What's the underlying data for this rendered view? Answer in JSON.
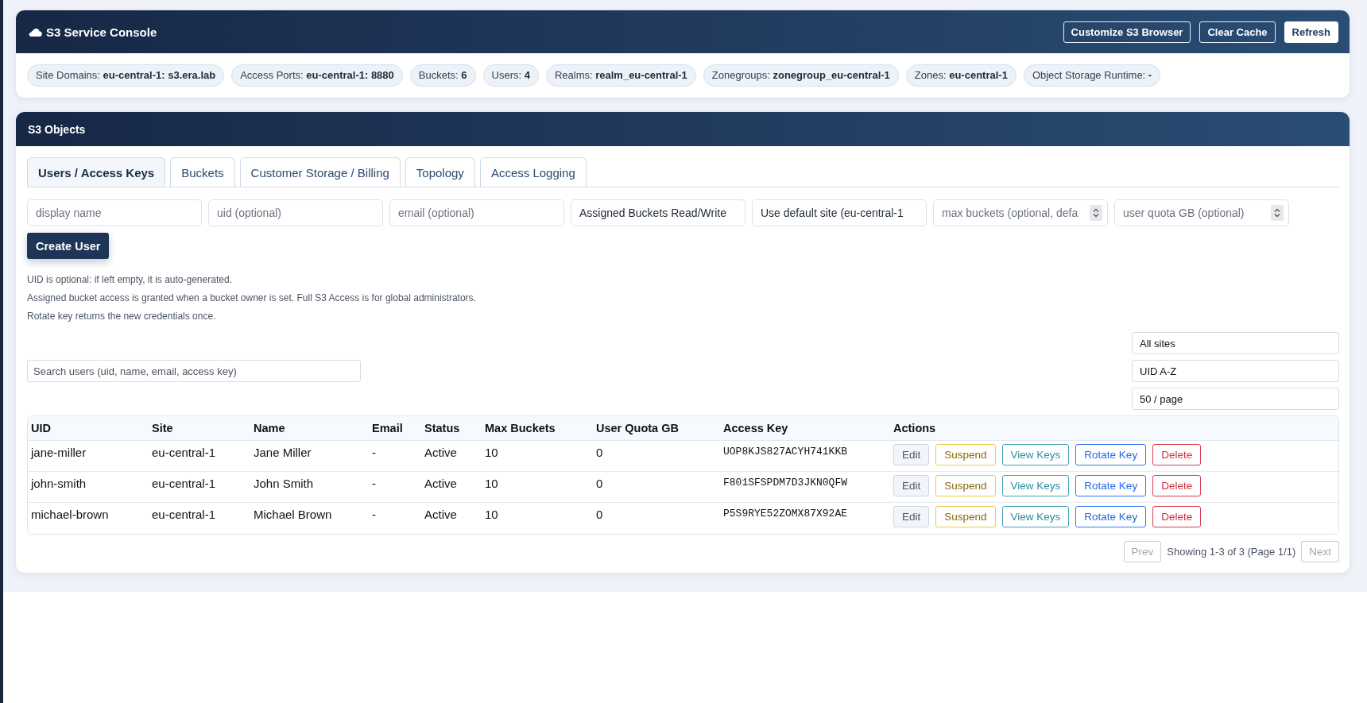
{
  "header": {
    "title": "S3 Service Console",
    "buttons": [
      {
        "label": "Customize S3 Browser",
        "kind": "outline"
      },
      {
        "label": "Clear Cache",
        "kind": "outline"
      },
      {
        "label": "Refresh",
        "kind": "solid"
      }
    ]
  },
  "summary": [
    {
      "text": "Site Domains: **eu-central-1: s3.era.lab**"
    },
    {
      "text": "Access Ports: **eu-central-1: 8880**"
    },
    {
      "text": "Buckets: **6**"
    },
    {
      "text": "Users: **4**"
    },
    {
      "text": "Realms: **realm_eu-central-1**"
    },
    {
      "text": "Zonegroups: **zonegroup_eu-central-1**"
    },
    {
      "text": "Zones: **eu-central-1**"
    },
    {
      "text": "Object Storage Runtime: **-**"
    }
  ],
  "objects": {
    "title": "S3 Objects",
    "tabs": [
      {
        "label": "Users / Access Keys",
        "selected": true
      },
      {
        "label": "Buckets",
        "selected": false
      },
      {
        "label": "Customer Storage / Billing",
        "selected": false
      },
      {
        "label": "Topology",
        "selected": false
      },
      {
        "label": "Access Logging",
        "selected": false
      }
    ],
    "form": {
      "fields": [
        {
          "kind": "text",
          "placeholder": "display name"
        },
        {
          "kind": "text",
          "placeholder": "uid (optional)"
        },
        {
          "kind": "text",
          "placeholder": "email (optional)"
        },
        {
          "kind": "select",
          "value": "Assigned Buckets Read/Write"
        },
        {
          "kind": "select",
          "value": "Use default site (eu-central-1"
        },
        {
          "kind": "number",
          "placeholder": "max buckets (optional, defa"
        },
        {
          "kind": "number",
          "placeholder": "user quota GB (optional)"
        }
      ],
      "submit": "Create User",
      "notes": [
        "UID is optional: if left empty, it is auto-generated.",
        "Assigned bucket access is granted when a bucket owner is set. Full S3 Access is for global administrators.",
        "Rotate key returns the new credentials once."
      ]
    },
    "search": {
      "placeholder": "Search users (uid, name, email, access key)"
    },
    "filters": [
      {
        "value": "All sites"
      },
      {
        "value": "UID A-Z"
      },
      {
        "value": "50 / page"
      }
    ],
    "table": {
      "columns": [
        {
          "label": "UID",
          "kind": "text"
        },
        {
          "label": "Site",
          "kind": "text"
        },
        {
          "label": "Name",
          "kind": "text"
        },
        {
          "label": "Email",
          "kind": "text"
        },
        {
          "label": "Status",
          "kind": "text"
        },
        {
          "label": "Max Buckets",
          "kind": "text"
        },
        {
          "label": "User Quota GB",
          "kind": "text"
        },
        {
          "label": "Access Key",
          "kind": "mono"
        },
        {
          "label": "Actions",
          "kind": "actions"
        }
      ],
      "rows": [
        {
          "cells": [
            "jane-miller",
            "eu-central-1",
            "Jane Miller",
            "-",
            "Active",
            "10",
            "0",
            "UOP8KJS827ACYH741KKB"
          ],
          "actions": [
            {
              "label": "Edit",
              "kind": "neutral"
            },
            {
              "label": "Suspend",
              "kind": "warning"
            },
            {
              "label": "View Keys",
              "kind": "info"
            },
            {
              "label": "Rotate Key",
              "kind": "primary"
            },
            {
              "label": "Delete",
              "kind": "danger"
            }
          ]
        },
        {
          "cells": [
            "john-smith",
            "eu-central-1",
            "John Smith",
            "-",
            "Active",
            "10",
            "0",
            "F801SFSPDM7D3JKN0QFW"
          ],
          "actions": [
            {
              "label": "Edit",
              "kind": "neutral"
            },
            {
              "label": "Suspend",
              "kind": "warning"
            },
            {
              "label": "View Keys",
              "kind": "info"
            },
            {
              "label": "Rotate Key",
              "kind": "primary"
            },
            {
              "label": "Delete",
              "kind": "danger"
            }
          ]
        },
        {
          "cells": [
            "michael-brown",
            "eu-central-1",
            "Michael Brown",
            "-",
            "Active",
            "10",
            "0",
            "P5S9RYE52ZOMX87X92AE"
          ],
          "actions": [
            {
              "label": "Edit",
              "kind": "neutral"
            },
            {
              "label": "Suspend",
              "kind": "warning"
            },
            {
              "label": "View Keys",
              "kind": "info"
            },
            {
              "label": "Rotate Key",
              "kind": "primary"
            },
            {
              "label": "Delete",
              "kind": "danger"
            }
          ]
        }
      ]
    },
    "pagination": {
      "prev": {
        "label": "Prev",
        "disabled": true
      },
      "info": "Showing 1-3 of 3 (Page 1/1)",
      "next": {
        "label": "Next",
        "disabled": true
      }
    }
  }
}
